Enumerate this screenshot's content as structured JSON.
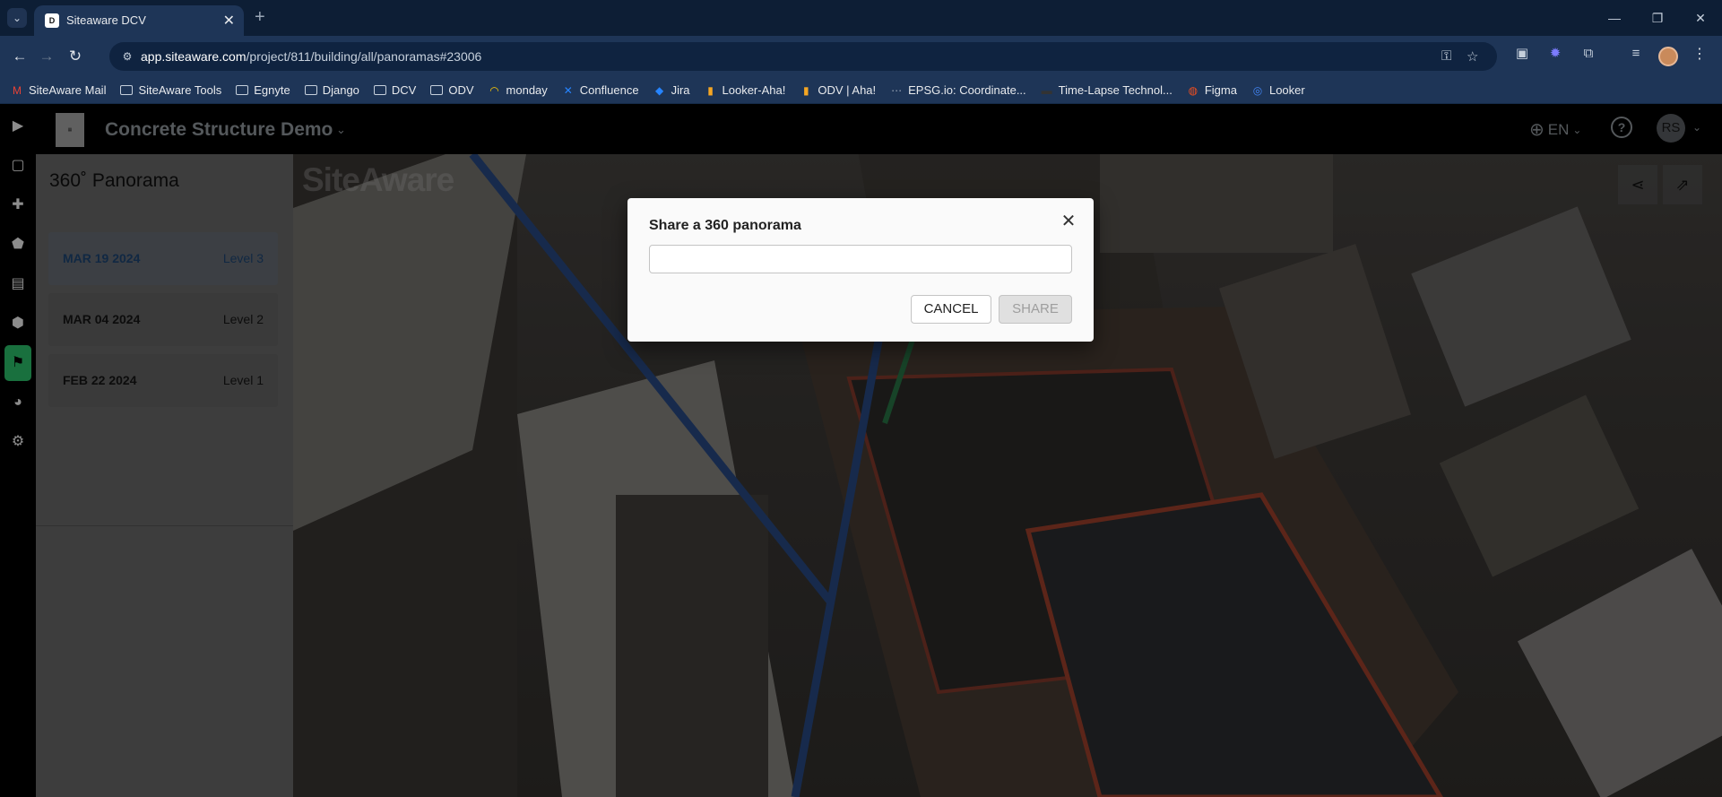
{
  "browser": {
    "tab_title": "Siteaware DCV",
    "tab_favicon": "D",
    "url_host": "app.siteaware.com",
    "url_path": "/project/811/building/all/panoramas#23006",
    "bookmarks": [
      {
        "label": "SiteAware Mail",
        "icon": "gmail-icon"
      },
      {
        "label": "SiteAware Tools",
        "icon": "folder-icon"
      },
      {
        "label": "Egnyte",
        "icon": "folder-icon"
      },
      {
        "label": "Django",
        "icon": "folder-icon"
      },
      {
        "label": "DCV",
        "icon": "folder-icon"
      },
      {
        "label": "ODV",
        "icon": "folder-icon"
      },
      {
        "label": "monday",
        "icon": "monday-icon"
      },
      {
        "label": "Confluence",
        "icon": "confluence-icon"
      },
      {
        "label": "Jira",
        "icon": "jira-icon"
      },
      {
        "label": "Looker-Aha!",
        "icon": "aha-icon"
      },
      {
        "label": "ODV | Aha!",
        "icon": "aha-icon"
      },
      {
        "label": "EPSG.io: Coordinate...",
        "icon": "epsg-icon"
      },
      {
        "label": "Time-Lapse Technol...",
        "icon": "timelapse-icon"
      },
      {
        "label": "Figma",
        "icon": "figma-icon"
      },
      {
        "label": "Looker",
        "icon": "looker-icon"
      }
    ]
  },
  "app": {
    "project_name": "Concrete Structure Demo",
    "language": "EN",
    "avatar_initials": "RS",
    "panel_title": "360˚ Panorama",
    "watermark": "SiteAware",
    "panoramas": [
      {
        "date": "MAR 19 2024",
        "level": "Level 3",
        "selected": true
      },
      {
        "date": "MAR 04 2024",
        "level": "Level 2",
        "selected": false
      },
      {
        "date": "FEB 22 2024",
        "level": "Level 1",
        "selected": false
      }
    ]
  },
  "modal": {
    "title": "Share a 360 panorama",
    "input_value": "",
    "input_placeholder": "",
    "cancel_label": "CANCEL",
    "share_label": "SHARE"
  },
  "colors": {
    "accent_green": "#2ecc71",
    "selected_text": "#1f4a7a",
    "chrome_bg": "#1e3557"
  }
}
